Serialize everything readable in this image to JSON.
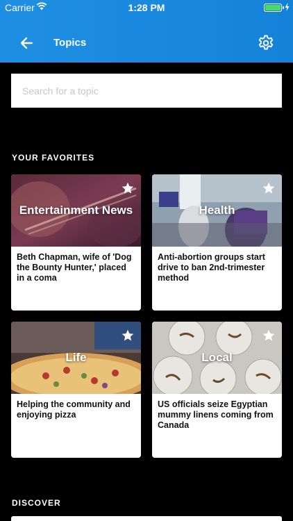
{
  "status_bar": {
    "carrier": "Carrier",
    "time": "1:28 PM"
  },
  "header": {
    "title": "Topics",
    "back_icon": "arrow-left-icon",
    "settings_icon": "gear-icon"
  },
  "search": {
    "placeholder": "Search for a topic",
    "value": ""
  },
  "favorites": {
    "label": "YOUR FAVORITES",
    "cards": [
      {
        "topic": "Entertainment News",
        "headline": "Beth Chapman, wife of 'Dog the Bounty Hunter,' placed in a coma"
      },
      {
        "topic": "Health",
        "headline": "Anti-abortion groups start drive to ban 2nd-trimester method"
      },
      {
        "topic": "Life",
        "headline": "Helping the community and enjoying pizza"
      },
      {
        "topic": "Local",
        "headline": "US officials seize Egyptian mummy linens coming from Canada"
      }
    ]
  },
  "discover": {
    "label": "DISCOVER"
  },
  "colors": {
    "header_blue": "#1a88e0",
    "background": "#000000",
    "card": "#ffffff"
  }
}
